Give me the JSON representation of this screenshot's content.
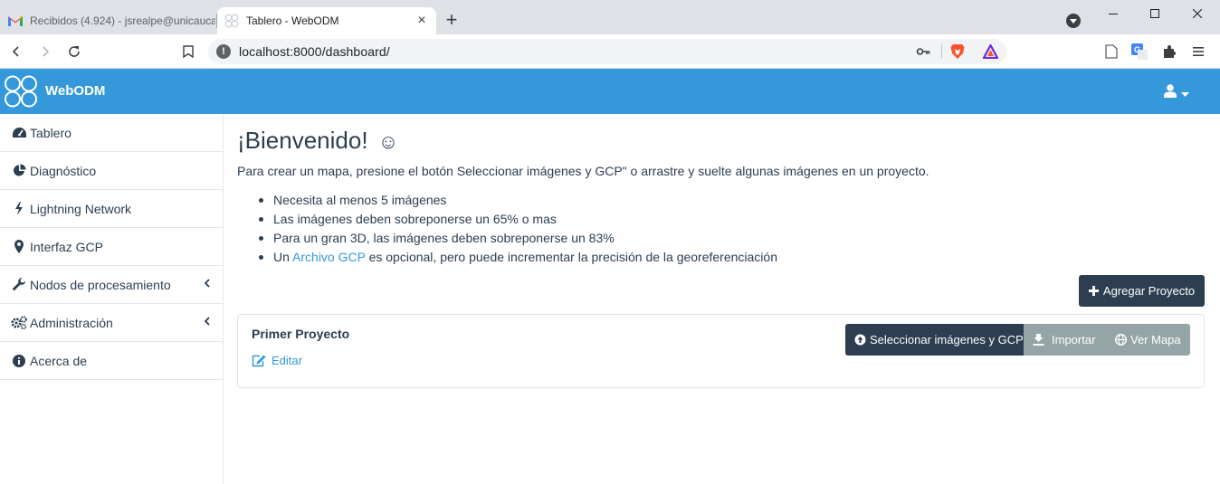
{
  "browser": {
    "tabs": [
      {
        "title": "Recibidos (4.924) - jsrealpe@unicauca",
        "favicon": "gmail-icon",
        "active": false
      },
      {
        "title": "Tablero - WebODM",
        "favicon": "webodm-icon",
        "active": true
      }
    ],
    "url": "localhost:8000/dashboard/"
  },
  "navbar": {
    "brand": "WebODM"
  },
  "sidebar": {
    "items": [
      {
        "label": "Tablero",
        "icon": "dashboard-icon"
      },
      {
        "label": "Diagnóstico",
        "icon": "pie-chart-icon"
      },
      {
        "label": "Lightning Network",
        "icon": "bolt-icon"
      },
      {
        "label": "Interfaz GCP",
        "icon": "map-marker-icon"
      },
      {
        "label": "Nodos de procesamiento",
        "icon": "wrench-icon",
        "expandable": true
      },
      {
        "label": "Administración",
        "icon": "cogs-icon",
        "expandable": true
      },
      {
        "label": "Acerca de",
        "icon": "info-circle-icon"
      }
    ]
  },
  "main": {
    "welcome": "¡Bienvenido!",
    "welcome_emoji": "☺",
    "intro": "Para crear un mapa, presione el botón Seleccionar imágenes y GCP\" o arrastre y suelte algunas imágenes en un proyecto.",
    "requirements": [
      "Necesita al menos 5 imágenes",
      "Las imágenes deben sobreponerse un 65% o mas",
      "Para un gran 3D, las imágenes deben sobreponerse un 83%"
    ],
    "gcp_prefix": "Un",
    "gcp_link": "Archivo GCP",
    "gcp_suffix": "es opcional, pero puede incrementar la precisión de la georeferenciación",
    "add_project": "Agregar Proyecto"
  },
  "project": {
    "name": "Primer Proyecto",
    "edit": "Editar",
    "select_images": "Seleccionar imágenes y GCP",
    "import": "Importar",
    "view_map": "Ver Mapa"
  },
  "colors": {
    "navbar": "#3498db",
    "primary_dark": "#2c3e50",
    "link": "#3498db",
    "button_gray": "#95a5a6"
  }
}
